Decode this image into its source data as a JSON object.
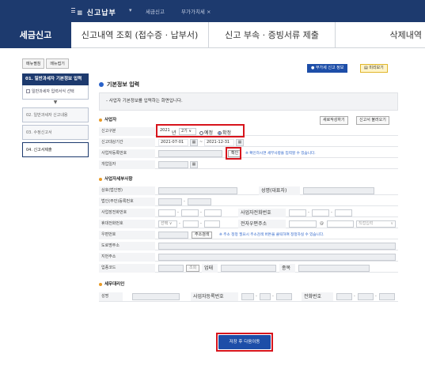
{
  "header": {
    "logo": "≡ 신고납부",
    "crumbs": [
      "세금신고",
      "부가가치세 ×"
    ],
    "sep": "▾"
  },
  "tabs": [
    {
      "label": "세금신고"
    },
    {
      "label": "신고내역 조회 (접수증 · 납부서)"
    },
    {
      "label": "신고 부속 · 증빙서류 제출"
    },
    {
      "label": "삭제내역"
    }
  ],
  "sidebar": {
    "btn_close": "메뉴펼침",
    "btn_open": "메뉴접기",
    "step1": "01. 일반과세자 기본정보 입력",
    "step1_sub": "일반과세자 입력서식 선택",
    "arrow": "▼",
    "step2": "02. 일반과세자 신고내용",
    "step3": "03. 수정신고서",
    "step4": "04. 신고서제출"
  },
  "toolbar": {
    "guide": "부가세 신고 정보",
    "preview": "미리보기"
  },
  "basic": {
    "title": "기본정보 입력",
    "notice": "사업자 기본정보를 입력하는 화면입니다.",
    "section": "사업자",
    "btn_new": "새로작성하기",
    "btn_load": "신고서 불러오기",
    "period_label": "신고구분",
    "year": "2021",
    "year_unit": "년",
    "term": "2기",
    "radio_pre": "예정",
    "radio_final": "확정",
    "range_label": "신고대상기간",
    "start": "2021-07-01",
    "end": "2021-12-31",
    "bizno_label": "사업자등록번호",
    "confirm": "확인",
    "bizno_note": "※ 확인하시면 세부사항을 입력할 수 있습니다.",
    "open_label": "개업일자",
    "cal": "▦",
    "tilde": "~"
  },
  "detail": {
    "section": "사업자세부사항",
    "corp_name": "상호(법인명)",
    "rep_name": "성명(대표자)",
    "corp_no": "법인(주민)등록번호",
    "office_phone": "사업장전화번호",
    "home_phone": "사업자전화번호",
    "mobile": "휴대전화번호",
    "select": "선택 ∨",
    "email": "전자우편주소",
    "at": "@",
    "direct": "직접입력",
    "zip": "우편번호",
    "addr_btn": "주소검색",
    "addr_note": "※ 주소 정정 필요시 주소검색 버튼을 클릭하여 정정하실 수 있습니다.",
    "road": "도로명주소",
    "lot": "지번주소",
    "biz_code": "업종코드",
    "lookup": "조회",
    "category": "업태",
    "item": "종목"
  },
  "agent": {
    "section": "세무대리인",
    "name": "성명",
    "bizno": "사업자등록번호",
    "phone": "전화번호"
  },
  "actions": {
    "save": "저장 후 다음이동"
  }
}
